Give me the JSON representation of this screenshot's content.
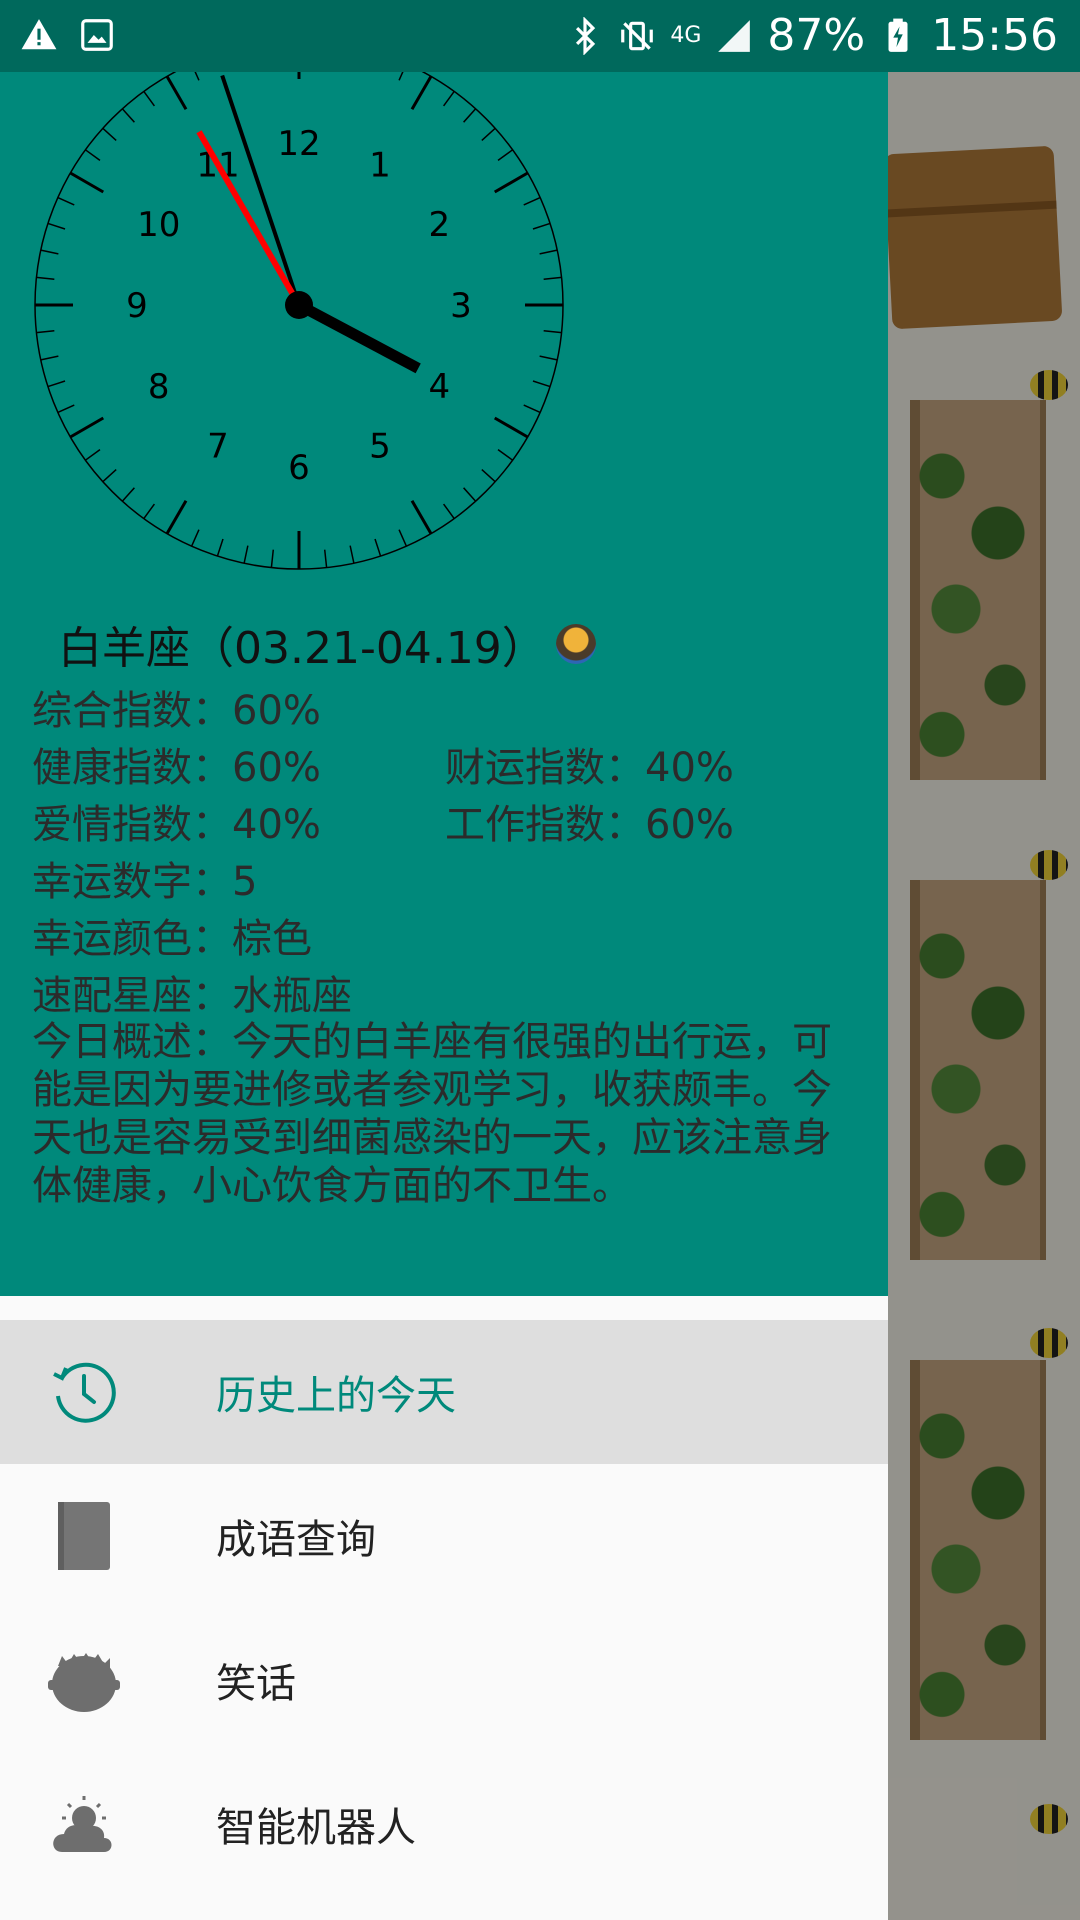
{
  "status_bar": {
    "battery": "87%",
    "time": "15:56",
    "network": "4G"
  },
  "horoscope": {
    "title": "白羊座（03.21-04.19）",
    "lines": [
      "综合指数：60%",
      "健康指数：60%",
      "财运指数：40%",
      "爱情指数：40%",
      "工作指数：60%",
      "幸运数字：5",
      "幸运颜色：棕色",
      "速配星座：水瓶座"
    ],
    "description": "今日概述：今天的白羊座有很强的出行运，可能是因为要进修或者参观学习，收获颇丰。今天也是容易受到细菌感染的一天，应该注意身体健康，小心饮食方面的不卫生。"
  },
  "menu": {
    "items": [
      {
        "label": "历史上的今天",
        "icon": "history-clock-icon",
        "active": true
      },
      {
        "label": "成语查询",
        "icon": "book-icon",
        "active": false
      },
      {
        "label": "笑话",
        "icon": "face-icon",
        "active": false
      },
      {
        "label": "智能机器人",
        "icon": "weather-cloud-icon",
        "active": false
      }
    ]
  },
  "colors": {
    "status_bar": "#00695c",
    "drawer_header": "#00897b",
    "active_item_bg": "#dedede",
    "active_text": "#00897b"
  }
}
